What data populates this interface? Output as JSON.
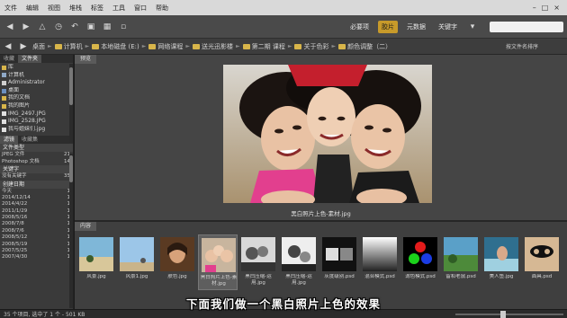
{
  "menubar": {
    "items": [
      "文件",
      "编辑",
      "视图",
      "堆栈",
      "标签",
      "工具",
      "窗口",
      "帮助"
    ]
  },
  "toolbar": {
    "workspaces": [
      "必要项",
      "胶片",
      "元数据",
      "关键字"
    ],
    "active_workspace": "胶片"
  },
  "path": {
    "crumbs": [
      "桌面",
      "计算机",
      "本地磁盘 (E:)",
      "网络课程",
      "送光迅影楼",
      "第二期 课程",
      "关于色彩",
      "颜色调整（二）"
    ],
    "sort_label": "按文件名排序"
  },
  "left": {
    "tabs": [
      "收藏",
      "文件夹"
    ],
    "folders": [
      "库",
      "计算机",
      "Administrator",
      "桌面",
      "我的文档",
      "我的图片",
      "IMG_2497.JPG",
      "IMG_2528.JPG",
      "我与姐妹们.jpg"
    ],
    "filter_tabs": [
      "滤镜",
      "收藏集"
    ],
    "filter_rows": [
      {
        "label": "文件类型",
        "count": "",
        "head": true
      },
      {
        "label": "JPEG 文件",
        "count": "21"
      },
      {
        "label": "Photoshop 文档",
        "count": "14"
      },
      {
        "label": "关键字",
        "count": "",
        "head": true
      },
      {
        "label": "没有关键字",
        "count": "35"
      },
      {
        "label": "创建日期",
        "count": "",
        "head": true
      },
      {
        "label": "今天",
        "count": "1"
      },
      {
        "label": "2014/12/14",
        "count": "1"
      },
      {
        "label": "2014/4/22",
        "count": "1"
      },
      {
        "label": "2011/1/29",
        "count": "1"
      },
      {
        "label": "2008/5/16",
        "count": "1"
      },
      {
        "label": "2008/7/8",
        "count": "1"
      },
      {
        "label": "2008/7/6",
        "count": "1"
      },
      {
        "label": "2008/5/12",
        "count": "1"
      },
      {
        "label": "2008/5/19",
        "count": "1"
      },
      {
        "label": "2007/5/25",
        "count": "1"
      },
      {
        "label": "2007/4/30",
        "count": "1"
      }
    ]
  },
  "preview": {
    "tab": "预览",
    "caption": "黑白照片上色-素材.jpg"
  },
  "content": {
    "tab": "内容",
    "thumbs": [
      {
        "label": "风景.jpg",
        "kind": "beach"
      },
      {
        "label": "风景1.jpg",
        "kind": "sky"
      },
      {
        "label": "肤色.jpg",
        "kind": "portrait"
      },
      {
        "label": "黑白照片上色-素材.jpg",
        "kind": "girls",
        "selected": true
      },
      {
        "label": "黑白压缩-运用.jpg",
        "kind": "bw1"
      },
      {
        "label": "黑白压缩-运用.jpg",
        "kind": "bw2"
      },
      {
        "label": "灰度级别.psd",
        "kind": "gray"
      },
      {
        "label": "混合模式.psd",
        "kind": "gradient"
      },
      {
        "label": "滤色模式.psd",
        "kind": "rgb"
      },
      {
        "label": "留和老鼠.psd",
        "kind": "landscape"
      },
      {
        "label": "美人鱼.jpg",
        "kind": "mermaid"
      },
      {
        "label": "面具.psd",
        "kind": "mask"
      }
    ]
  },
  "statusbar": {
    "text": "35 个项目, 选中了 1 个 - 501 KB"
  },
  "subtitle": "下面我们做一个黑白照片上色的效果",
  "colors": {
    "accent": "#c79a2a",
    "folder": "#d8b54a"
  }
}
